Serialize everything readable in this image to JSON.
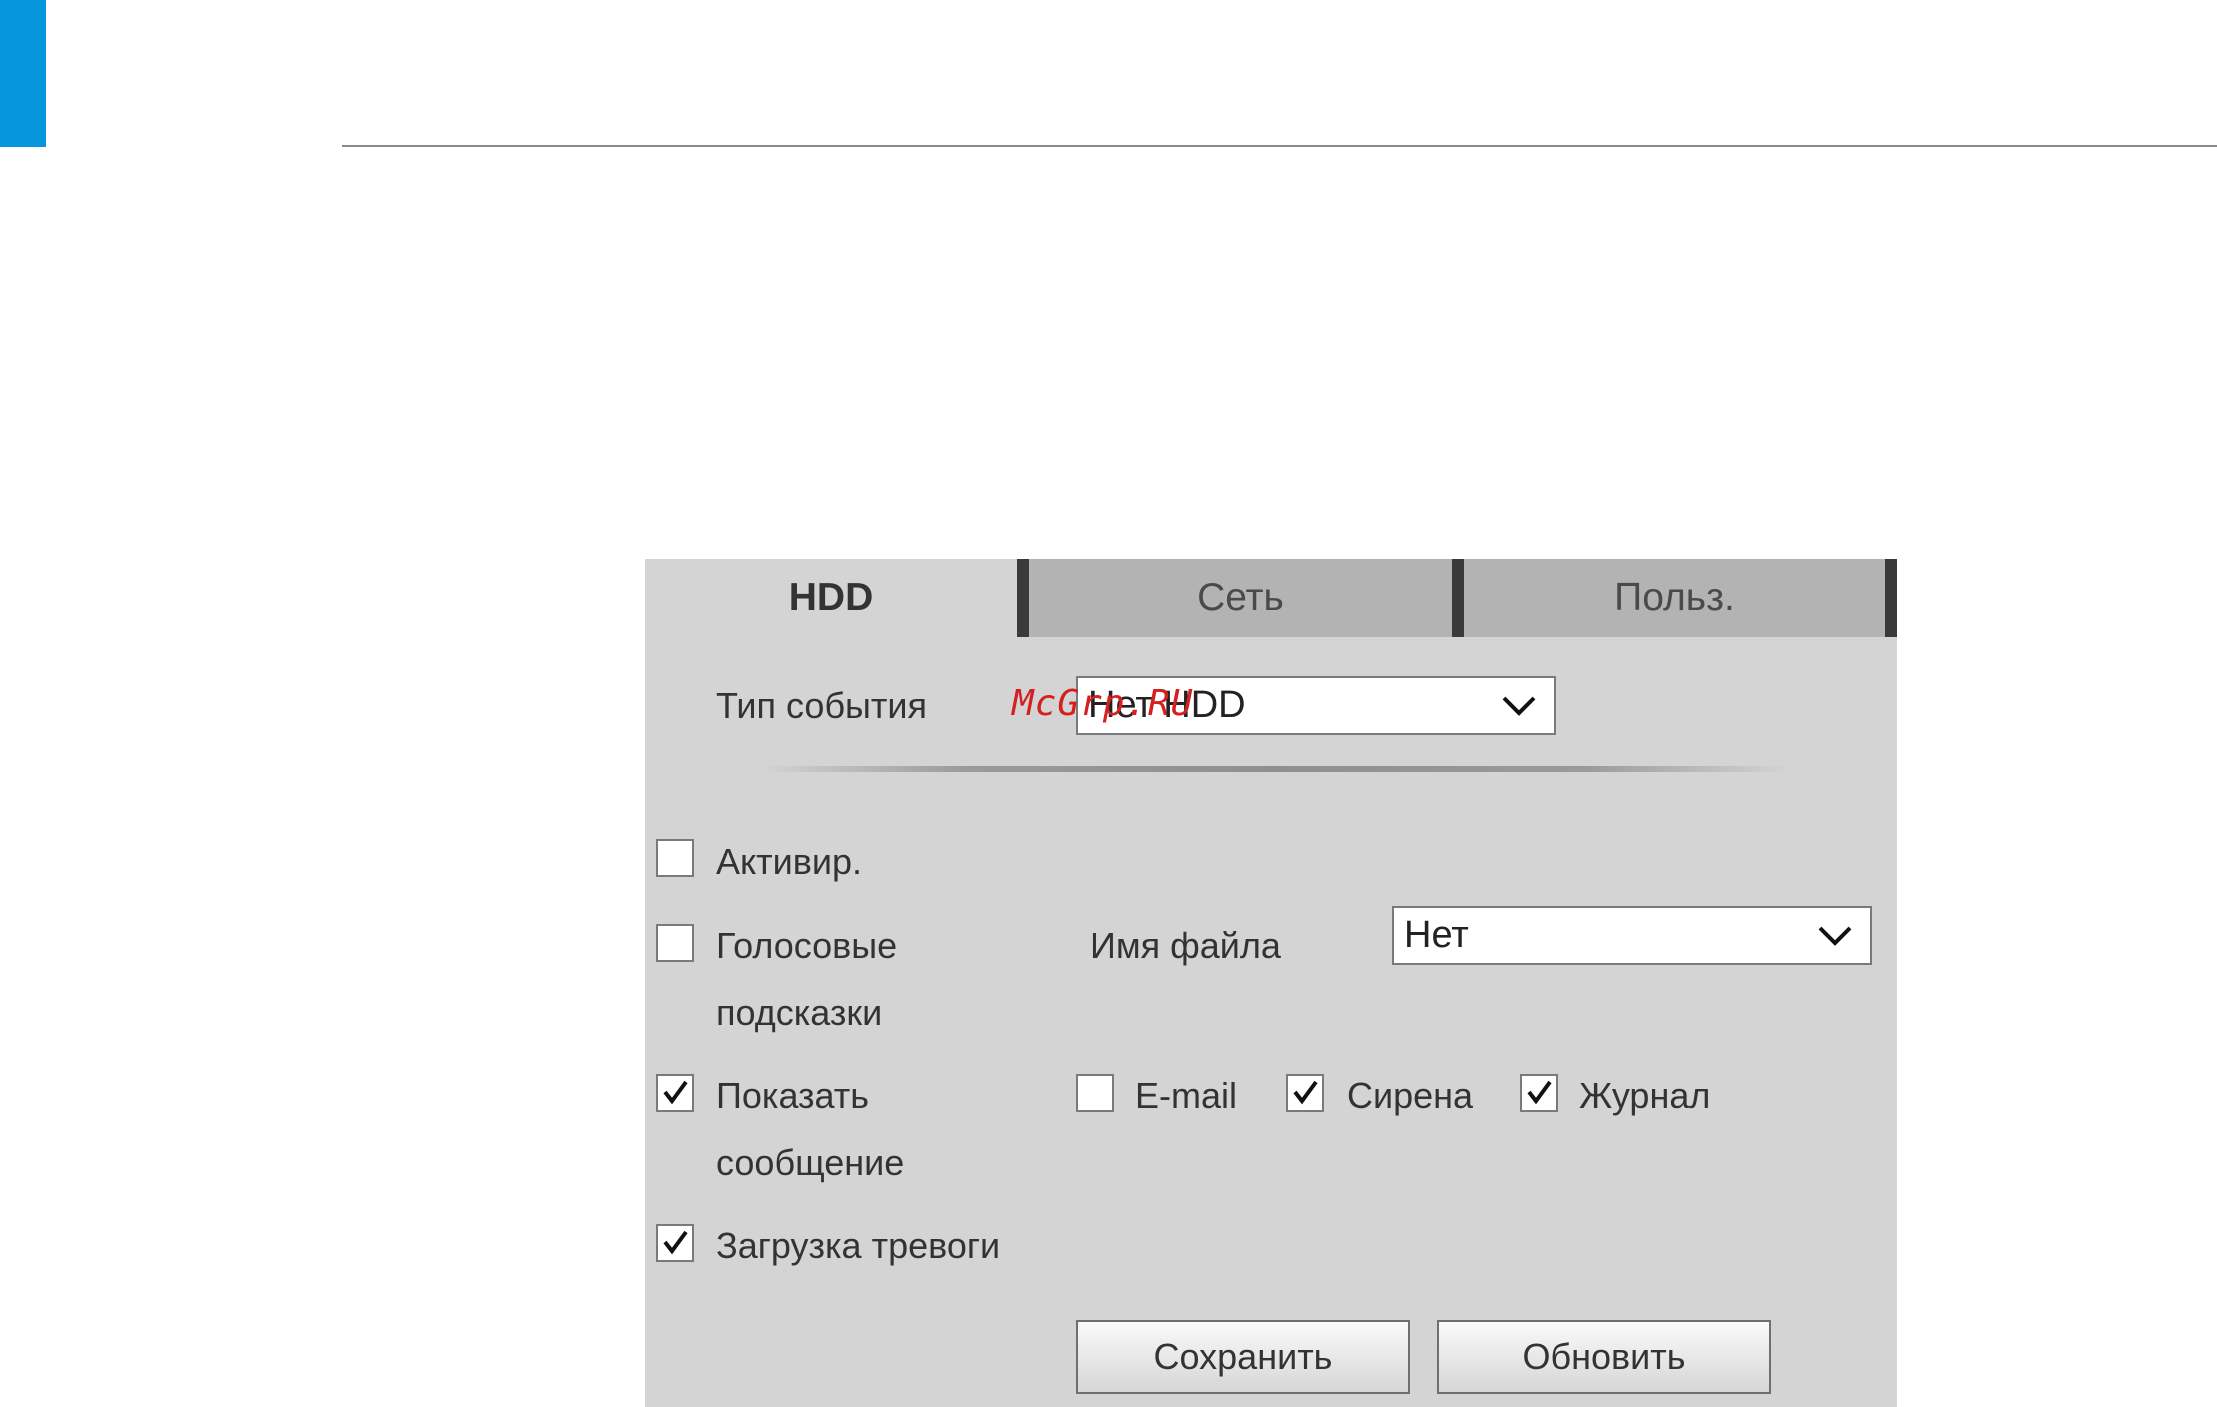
{
  "tabs": [
    {
      "label": "HDD",
      "active": true
    },
    {
      "label": "Сеть",
      "active": false
    },
    {
      "label": "Польз.",
      "active": false
    }
  ],
  "event_type": {
    "label": "Тип события",
    "value": "Нет HDD"
  },
  "options": {
    "activate": {
      "label": "Активир.",
      "checked": false
    },
    "voice_prompts": {
      "label_line1": "Голосовые",
      "label_line2": "подсказки",
      "checked": false
    },
    "file_name": {
      "label": "Имя файла",
      "value": "Нет"
    },
    "show_message": {
      "label_line1": "Показать",
      "label_line2": "сообщение",
      "checked": true
    },
    "email": {
      "label": "E-mail",
      "checked": false
    },
    "siren": {
      "label": "Сирена",
      "checked": true
    },
    "log": {
      "label": "Журнал",
      "checked": true
    },
    "alarm_upload": {
      "label": "Загрузка тревоги",
      "checked": true
    }
  },
  "buttons": {
    "save": "Сохранить",
    "refresh": "Обновить"
  },
  "watermark": "McGrp.RU",
  "colors": {
    "accent": "#0596de",
    "panel": "#d4d4d4",
    "tab_inactive": "#b3b3b3",
    "watermark": "#d42020"
  }
}
